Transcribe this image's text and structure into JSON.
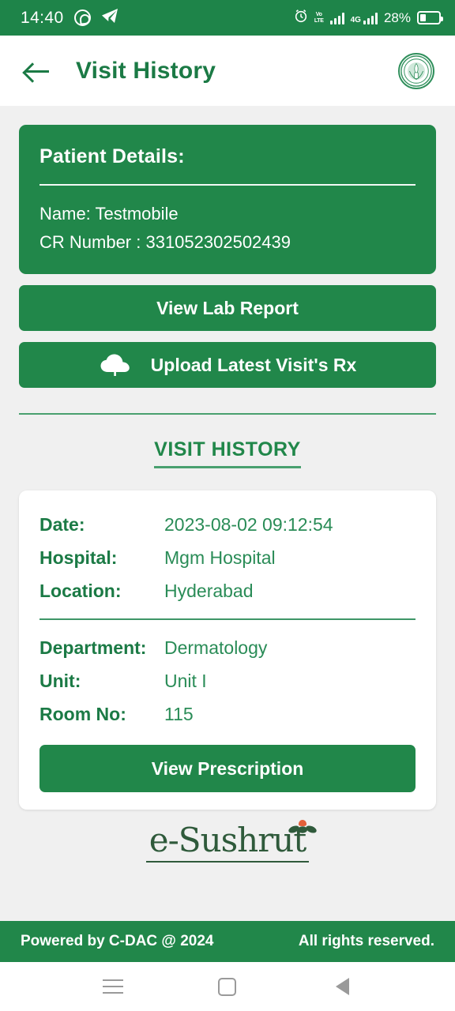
{
  "status_bar": {
    "time": "14:40",
    "whatsapp_icon": "whatsapp-icon",
    "telegram_icon": "telegram-icon",
    "alarm_icon": "alarm-icon",
    "volte_line1": "Vo",
    "volte_line2": "LTE",
    "network_label": "4G",
    "battery_percent": "28%"
  },
  "app_bar": {
    "back_icon": "back-arrow-icon",
    "title": "Visit History",
    "emblem": "government-emblem"
  },
  "patient": {
    "title": "Patient Details:",
    "name_line": "Name: Testmobile",
    "cr_line": "CR Number : 331052302502439"
  },
  "actions": {
    "view_lab_report": "View Lab Report",
    "upload_rx": "Upload Latest Visit's Rx",
    "upload_icon": "cloud-upload-icon"
  },
  "section": {
    "visit_history_title": "VISIT HISTORY"
  },
  "visit": {
    "rows_top": [
      {
        "label": "Date:",
        "value": "2023-08-02 09:12:54"
      },
      {
        "label": "Hospital:",
        "value": "Mgm Hospital"
      },
      {
        "label": "Location:",
        "value": "Hyderabad"
      }
    ],
    "rows_bottom": [
      {
        "label": "Department:",
        "value": "Dermatology"
      },
      {
        "label": "Unit:",
        "value": "Unit I"
      },
      {
        "label": "Room No:",
        "value": "115"
      }
    ],
    "view_prescription": "View Prescription"
  },
  "logo": {
    "text": "e-Sushrut"
  },
  "footer": {
    "powered_by": "Powered by C-DAC @ 2024",
    "rights": "All rights reserved."
  },
  "nav_bar": {
    "recents": "recents-icon",
    "home": "home-icon",
    "back": "back-icon"
  },
  "colors": {
    "brand_green": "#21874a",
    "dark_green": "#1b7a45",
    "page_bg": "#f0f0f0"
  }
}
